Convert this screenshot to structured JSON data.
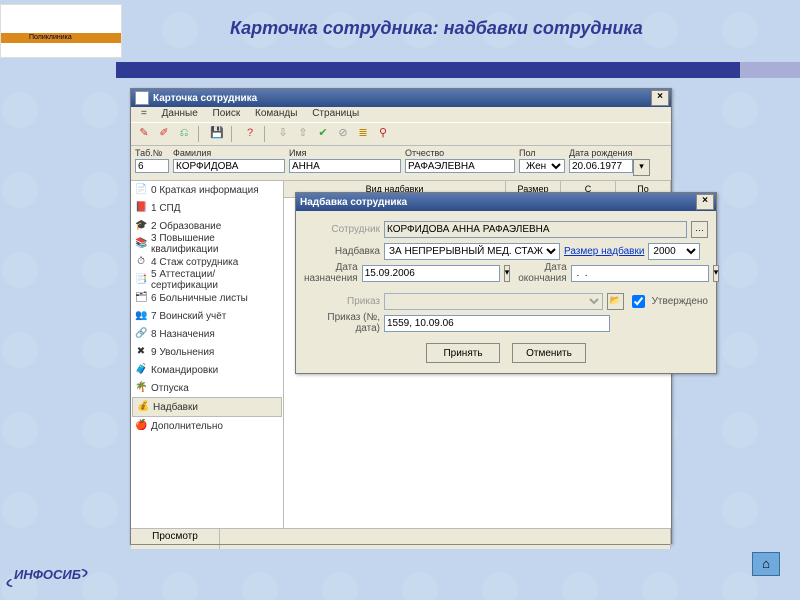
{
  "slide": {
    "title": "Карточка сотрудника: надбавки сотрудника",
    "brand_top": "Поликлиника",
    "brand_bottom": "ИНФОСИБ"
  },
  "window": {
    "title": "Карточка сотрудника",
    "menu": [
      "=",
      "Данные",
      "Поиск",
      "Команды",
      "Страницы"
    ],
    "fields": {
      "tab_no_label": "Таб.№",
      "tab_no": "6",
      "surname_label": "Фамилия",
      "surname": "КОРФИДОВА",
      "name_label": "Имя",
      "name": "АННА",
      "patronymic_label": "Отчество",
      "patronymic": "РАФАЭЛЕВНА",
      "sex_label": "Пол",
      "sex": "Жен.",
      "dob_label": "Дата рождения",
      "dob": "20.06.1977"
    },
    "nav": [
      {
        "icon": "📄",
        "label": "0 Краткая информация"
      },
      {
        "icon": "📕",
        "label": "1 СПД"
      },
      {
        "icon": "🎓",
        "label": "2 Образование"
      },
      {
        "icon": "📚",
        "label": "3 Повышение квалификации"
      },
      {
        "icon": "⏱",
        "label": "4 Стаж сотрудника"
      },
      {
        "icon": "📑",
        "label": "5 Аттестации/сертификации"
      },
      {
        "icon": "🗂",
        "label": "6 Больничные листы"
      },
      {
        "icon": "👥",
        "label": "7 Воинский учёт"
      },
      {
        "icon": "🔗",
        "label": "8 Назначения"
      },
      {
        "icon": "✖",
        "label": "9 Увольнения"
      },
      {
        "icon": "🧳",
        "label": "Командировки"
      },
      {
        "icon": "🌴",
        "label": "Отпуска"
      },
      {
        "icon": "💰",
        "label": "Надбавки",
        "selected": true
      },
      {
        "icon": "🍎",
        "label": "Дополнительно"
      }
    ],
    "columns": {
      "c1": "Вид надбавки",
      "c2": "Размер",
      "c3": "С",
      "c4": "По"
    },
    "status": {
      "cell1": "Просмотр"
    }
  },
  "dialog": {
    "title": "Надбавка сотрудника",
    "employee_label": "Сотрудник",
    "employee": "КОРФИДОВА АННА РАФАЭЛЕВНА",
    "bonus_label": "Надбавка",
    "bonus": "ЗА НЕПРЕРЫВНЫЙ МЕД. СТАЖ",
    "size_link": "Размер надбавки",
    "size": "2000",
    "date_from_label": "Дата назначения",
    "date_from": "15.09.2006",
    "date_to_label": "Дата окончания",
    "date_to": " .  .",
    "order_label": "Приказ",
    "order": "",
    "order_details_label": "Приказ (№, дата)",
    "order_details": "1559, 10.09.06",
    "approved_label": "Утверждено",
    "approved": true,
    "ok": "Принять",
    "cancel": "Отменить"
  }
}
